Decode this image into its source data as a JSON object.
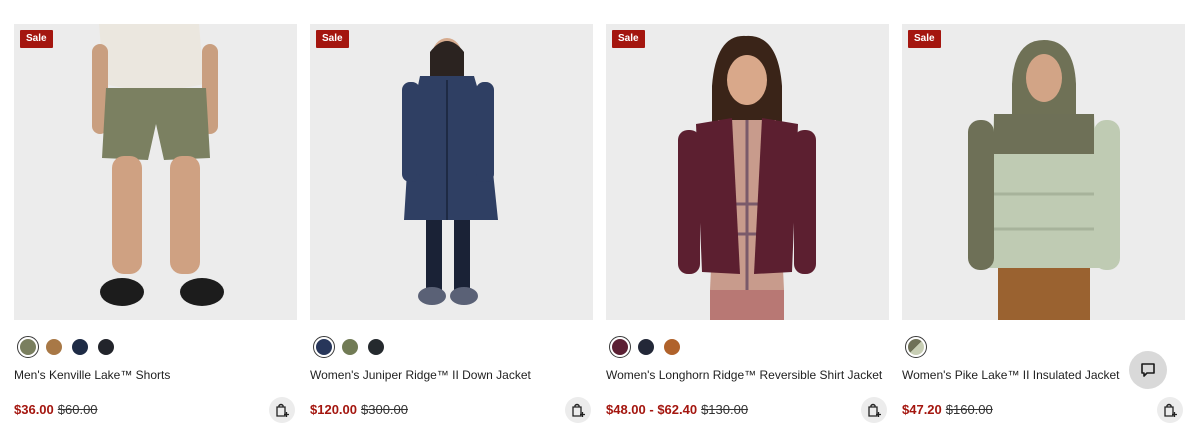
{
  "products": [
    {
      "badge": "Sale",
      "name": "Men's Kenville Lake™ Shorts",
      "sale_price": "$36.00",
      "original_price": "$60.00",
      "swatches": [
        "#7a7f5f",
        "#a87846",
        "#1e2b45",
        "#22242b"
      ],
      "selected_swatch": 0,
      "image_subject": "man wearing olive shorts, white tee and black shoes"
    },
    {
      "badge": "Sale",
      "name": "Women's Juniper Ridge™ II Down Jacket",
      "sale_price": "$120.00",
      "original_price": "$300.00",
      "swatches": [
        "#27365a",
        "#717b55",
        "#252a2e"
      ],
      "selected_swatch": 0,
      "image_subject": "woman wearing long navy down parka"
    },
    {
      "badge": "Sale",
      "name": "Women's Longhorn Ridge™ Reversible Shirt Jacket",
      "sale_price": "$48.00 - $62.40",
      "original_price": "$130.00",
      "swatches": [
        "#5b1f33",
        "#232838",
        "#b0622b"
      ],
      "selected_swatch": 0,
      "image_subject": "woman wearing burgundy shirt jacket over plaid shirt"
    },
    {
      "badge": "Sale",
      "name": "Women's Pike Lake™ II Insulated Jacket",
      "sale_price": "$47.20",
      "original_price": "$160.00",
      "swatches": [
        "#b3b58f"
      ],
      "selected_swatch": 0,
      "image_subject": "woman wearing sage and olive puffer jacket"
    }
  ],
  "icons": {
    "quick_add": "shopping-bag-plus-icon",
    "chat": "chat-bubble-icon"
  },
  "colors": {
    "sale": "#a4160f"
  }
}
